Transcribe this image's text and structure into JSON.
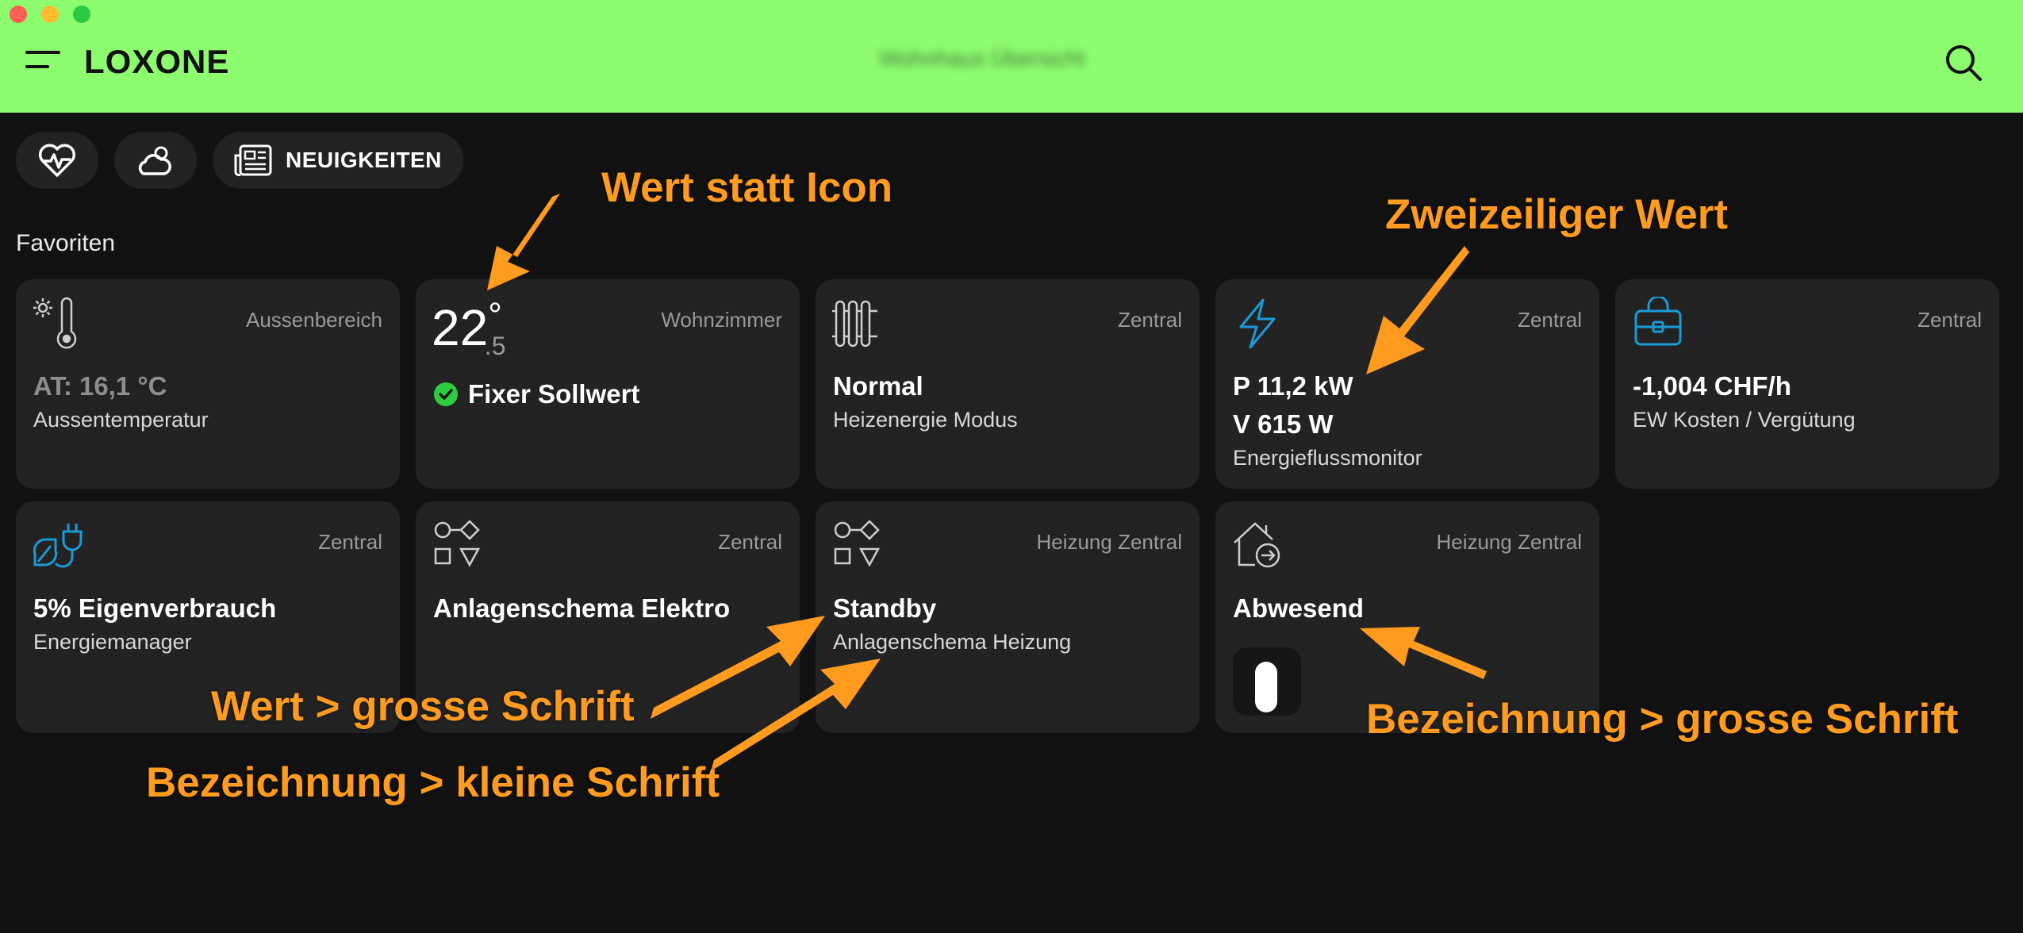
{
  "app": {
    "logo": "LOXONE",
    "house_name": "Wohnhaus Übersicht"
  },
  "quick_buttons": {
    "news_label": "NEUIGKEITEN"
  },
  "section": {
    "favorites_title": "Favoriten"
  },
  "cards": [
    {
      "room": "Aussenbereich",
      "value": "AT: 16,1 °C",
      "name": "Aussentemperatur",
      "icon": "sun-thermometer-icon"
    },
    {
      "room": "Wohnzimmer",
      "temp_int": "22",
      "temp_deg": "°",
      "temp_dec": ".5",
      "value": "Fixer Sollwert",
      "icon": "check-circle-icon",
      "status_color": "#2ecc40"
    },
    {
      "room": "Zentral",
      "value": "Normal",
      "name": "Heizenergie Modus",
      "icon": "radiator-icon"
    },
    {
      "room": "Zentral",
      "value_line1": "P 11,2 kW",
      "value_line2": "V 615 W",
      "name": "Energieflussmonitor",
      "icon": "lightning-icon"
    },
    {
      "room": "Zentral",
      "value": "-1,004 CHF/h",
      "name": "EW Kosten / Vergütung",
      "icon": "money-bag-icon"
    },
    {
      "room": "Zentral",
      "value": "5% Eigenverbrauch",
      "name": "Energiemanager",
      "icon": "eco-plug-icon"
    },
    {
      "room": "Zentral",
      "value": "Anlagenschema Elektro",
      "icon": "shapes-icon"
    },
    {
      "room": "Heizung Zentral",
      "value": "Standby",
      "name": "Anlagenschema Heizung",
      "icon": "shapes-icon"
    },
    {
      "room": "Heizung Zentral",
      "value": "Abwesend",
      "icon": "house-leave-icon"
    }
  ],
  "annotations": {
    "wert_statt_icon": "Wert statt Icon",
    "zweizeilig": "Zweizeiliger Wert",
    "wert_gross": "Wert  > grosse Schrift",
    "bezeichnung_klein": "Bezeichnung > kleine Schrift",
    "bezeichnung_gross": "Bezeichnung > grosse Schrift"
  },
  "colors": {
    "header_bg": "#8cfb6e",
    "accent_blue": "#1a9bd7",
    "annotation": "#ff9b1e",
    "card_bg": "#232323"
  }
}
